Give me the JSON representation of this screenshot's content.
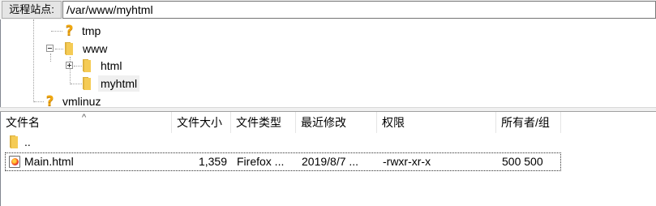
{
  "address_bar": {
    "label": "远程站点:",
    "path": "/var/www/myhtml"
  },
  "tree": {
    "items": [
      {
        "name": "tmp",
        "icon": "unknown-question-icon"
      },
      {
        "name": "www",
        "icon": "folder-icon",
        "expanded": true
      },
      {
        "name": "html",
        "icon": "folder-icon",
        "expanded": false
      },
      {
        "name": "myhtml",
        "icon": "folder-icon",
        "selected": true
      },
      {
        "name": "vmlinuz",
        "icon": "unknown-question-icon"
      }
    ]
  },
  "file_list": {
    "columns": [
      "文件名",
      "文件大小",
      "文件类型",
      "最近修改",
      "权限",
      "所有者/组"
    ],
    "sort_indicator": "^",
    "parent_row": {
      "name": ".."
    },
    "rows": [
      {
        "name": "Main.html",
        "size": "1,359",
        "type": "Firefox ...",
        "modified": "2019/8/7 ...",
        "permissions": "-rwxr-xr-x",
        "owner": "500 500"
      }
    ]
  },
  "colors": {
    "folder": "#f5cb55",
    "question_icon": "#f0a810",
    "panel_bg": "#f0f0f0",
    "border": "#828790"
  }
}
